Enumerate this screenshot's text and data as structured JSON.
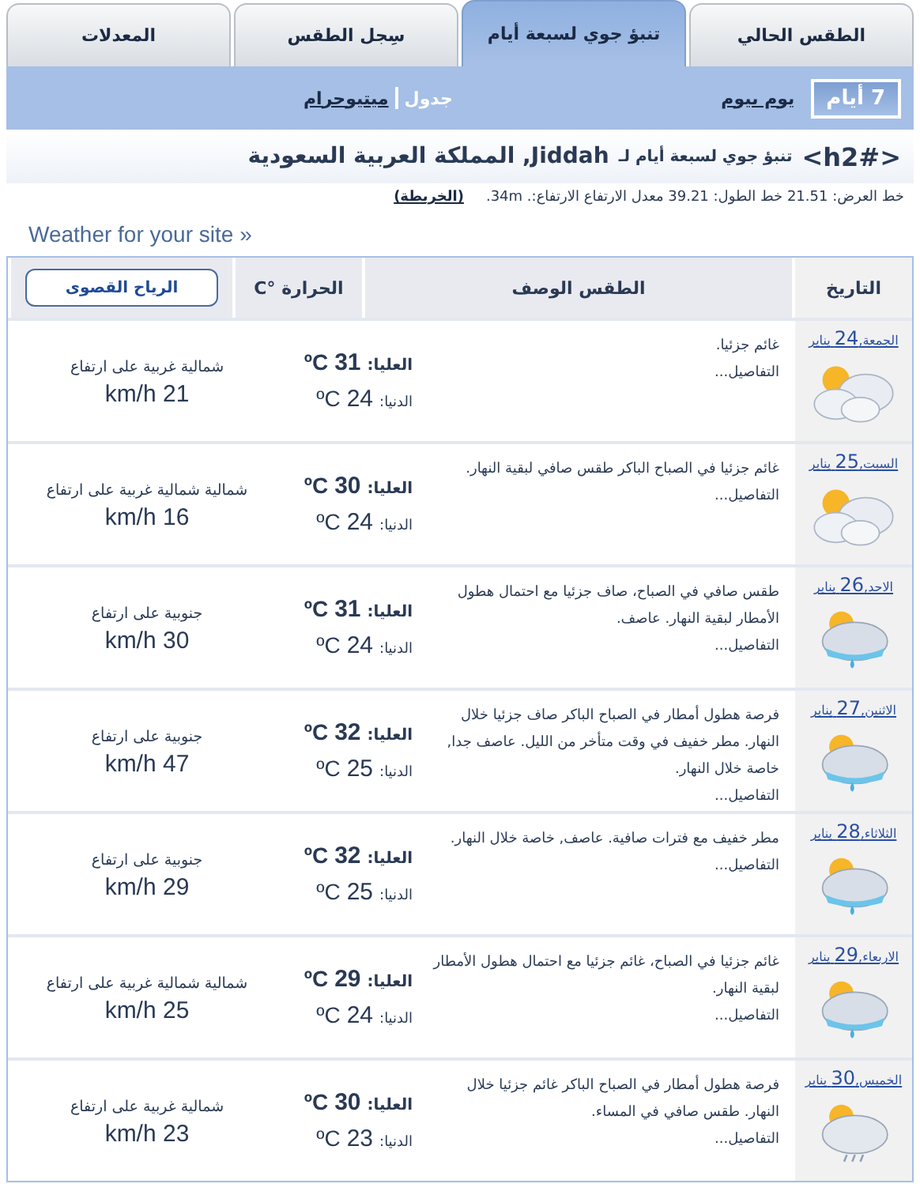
{
  "tabs": [
    {
      "label": "الطقس الحالي",
      "selected": false
    },
    {
      "label": "تنبؤ جوي لسبعة أيام",
      "selected": true
    },
    {
      "label": "سِجل الطقس",
      "selected": false
    },
    {
      "label": "المعدلات",
      "selected": false
    }
  ],
  "period_nav": [
    {
      "label": "7 أيام",
      "selected": true
    },
    {
      "label": "يوم بيوم",
      "selected": false
    }
  ],
  "view_nav": [
    {
      "label": "جدول",
      "selected": true
    },
    {
      "label": "ميتيوجرام",
      "selected": false
    }
  ],
  "heading": {
    "tag": "<h2#>",
    "prefix": "تنبؤ جوي لسبعة أيام لـ",
    "place": "Jiddah, المملكة العربية السعودية"
  },
  "coordinates": {
    "text": "خط العرض: 21.51 خط الطول: 39.21 معدل الارتفاع الارتفاع:. 34m.",
    "map_link": "(الخريطة)"
  },
  "site_link": "Weather for your site »",
  "table": {
    "columns": [
      "التاريخ",
      "الطقس الوصف",
      "الحرارة °C"
    ],
    "wind_button": "الرياح القصوى",
    "rows": [
      {
        "day": "الجمعة,",
        "date": "24",
        "month": "يناير",
        "kind": "cloudy",
        "description": "غائم جزئيا.",
        "details": "التفاصيل...",
        "high_label": "العليا:",
        "high": "31",
        "low_label": "الدنيا:",
        "low": "24",
        "unit_high": "ºC",
        "unit_low": "ºC",
        "wind": "شمالية غربية  على ارتفاع",
        "speed": "21 km/h"
      },
      {
        "day": "السبت,",
        "date": "25",
        "month": "يناير",
        "kind": "cloudy",
        "description": "غائم جزئيا في الصباح الباكر طقس صافي لبقية النهار.",
        "details": "التفاصيل...",
        "high_label": "العليا:",
        "high": "30",
        "low_label": "الدنيا:",
        "low": "24",
        "unit_high": "ºC",
        "unit_low": "ºC",
        "wind": "شمالية شمالية غربية على ارتفاع",
        "speed": "16 km/h"
      },
      {
        "day": "الاحد,",
        "date": "26",
        "month": "يناير",
        "kind": "showers",
        "description": "طقس صافي في الصباح، صاف جزئيا مع احتمال هطول الأمطار لبقية النهار. عاصف.",
        "details": "التفاصيل...",
        "high_label": "العليا:",
        "high": "31",
        "low_label": "الدنيا:",
        "low": "24",
        "unit_high": "ºC",
        "unit_low": "ºC",
        "wind": "جنوبية  على ارتفاع",
        "speed": "30 km/h"
      },
      {
        "day": "الاثنين,",
        "date": "27",
        "month": "يناير",
        "kind": "showers",
        "description": "فرصة هطول أمطار في الصباح الباكر  صاف جزئيا خلال النهار. مطر خفيف في وقت متأخر من الليل. عاصف جدا, خاصة خلال النهار.",
        "details": "التفاصيل...",
        "high_label": "العليا:",
        "high": "32",
        "low_label": "الدنيا:",
        "low": "25",
        "unit_high": "ºC",
        "unit_low": "ºC",
        "wind": "جنوبية  على ارتفاع",
        "speed": "47 km/h"
      },
      {
        "day": "الثلاثاء,",
        "date": "28",
        "month": "يناير",
        "kind": "showers",
        "description": "مطر خفيف مع فترات صافية. عاصف, خاصة خلال النهار.",
        "details": "التفاصيل...",
        "high_label": "العليا:",
        "high": "32",
        "low_label": "الدنيا:",
        "low": "25",
        "unit_high": "ºC",
        "unit_low": "ºC",
        "wind": "جنوبية  على ارتفاع",
        "speed": "29 km/h"
      },
      {
        "day": "الاربعاء,",
        "date": "29",
        "month": "يناير",
        "kind": "showers",
        "description": "غائم جزئيا في الصباح، غائم جزئيا مع احتمال هطول الأمطار لبقية النهار.",
        "details": "التفاصيل...",
        "high_label": "العليا:",
        "high": "29",
        "low_label": "الدنيا:",
        "low": "24",
        "unit_high": "ºC",
        "unit_low": "ºC",
        "wind": "شمالية شمالية غربية على ارتفاع",
        "speed": "25 km/h"
      },
      {
        "day": "الخميس,",
        "date": "30",
        "month": "يناير",
        "kind": "drizzle",
        "description": "فرصة هطول أمطار في الصباح الباكر  غائم جزئيا خلال النهار. طقس صافي في المساء.",
        "details": "التفاصيل...",
        "high_label": "العليا:",
        "high": "30",
        "low_label": "الدنيا:",
        "low": "23",
        "unit_high": "ºC",
        "unit_low": "ºC",
        "wind": "شمالية غربية  على ارتفاع",
        "speed": "23 km/h"
      }
    ]
  }
}
